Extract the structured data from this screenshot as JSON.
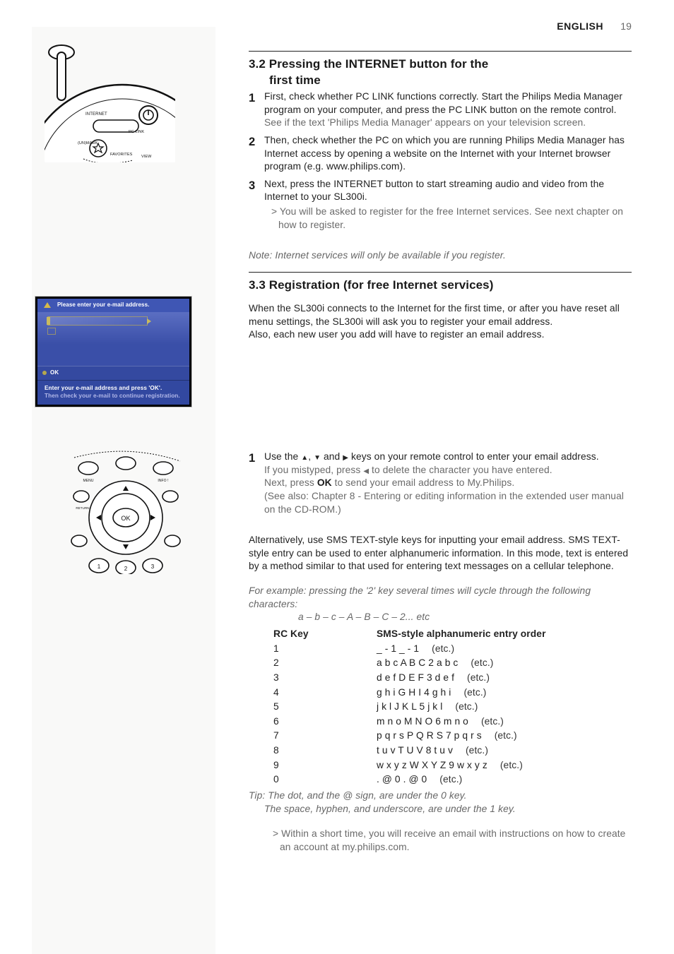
{
  "header": {
    "language": "ENGLISH",
    "page_number": "19"
  },
  "section32": {
    "heading_line1": "3.2 Pressing the INTERNET button for the",
    "heading_line2": "first time",
    "items": [
      {
        "num": "1",
        "main": "First, check whether PC LINK functions correctly. Start the Philips Media Manager program on your computer, and press the PC LINK button on the remote control.",
        "sub": "See if the text 'Philips Media Manager' appears on your television screen."
      },
      {
        "num": "2",
        "main": "Then, check whether the PC on which you are running Philips Media Manager has Internet access by opening a website on the Internet with your Internet browser program (e.g. www.philips.com).",
        "sub": ""
      },
      {
        "num": "3",
        "main": "Next, press the INTERNET button to start streaming audio and video from the Internet to your SL300i.",
        "sub": "",
        "angle": "> You will be asked to register for the free Internet services. See next chapter on how to register."
      }
    ],
    "note": "Note: Internet services will only be available if you register."
  },
  "section33": {
    "heading": "3.3 Registration (for free Internet services)",
    "intro": "When the SL300i connects to the Internet for the first time, or after you have reset all menu settings, the SL300i will ask you to register your email address.",
    "intro2": "Also, each new user you add will have to register an email address.",
    "step1": {
      "num": "1",
      "line1_pre": "Use the ",
      "line1_mid1": ", ",
      "line1_mid2": " and ",
      "line1_post": " keys on your remote control to enter your email address.",
      "line2_pre": "If you mistyped, press ",
      "line2_post": " to delete the character you have entered.",
      "line3_pre": "Next, press ",
      "line3_bold": "OK",
      "line3_post": " to send your email address to My.Philips.",
      "line4": "(See also: Chapter 8 - Entering or editing information in the extended user manual on the CD-ROM.)"
    },
    "alt_para": "Alternatively, use SMS TEXT-style keys for inputting your email address. SMS TEXT-style entry can be used to enter alphanumeric information. In this mode, text is entered by a method similar to that used for entering text messages on a cellular telephone.",
    "example_line1": "For example: pressing the '2' key several times will cycle through the following characters:",
    "example_line2": "a – b – c – A – B – C – 2... etc",
    "table": {
      "head_key": "RC Key",
      "head_val": "SMS-style alphanumeric entry order",
      "etc": "(etc.)",
      "rows": [
        {
          "key": "1",
          "val": "_  -  1  _  -  1"
        },
        {
          "key": "2",
          "val": "a  b  c  A  B  C  2  a  b  c"
        },
        {
          "key": "3",
          "val": "d  e  f  D  E  F  3  d  e  f"
        },
        {
          "key": "4",
          "val": "g  h  i  G  H  I  4  g  h  i"
        },
        {
          "key": "5",
          "val": "j  k  l  J  K  L  5  j  k  l"
        },
        {
          "key": "6",
          "val": "m  n  o  M  N  O  6  m  n  o"
        },
        {
          "key": "7",
          "val": "p  q  r  s  P  Q  R  S  7  p  q  r  s"
        },
        {
          "key": "8",
          "val": "t  u  v  T  U  V  8  t  u  v"
        },
        {
          "key": "9",
          "val": "w  x  y  z  W  X  Y  Z  9  w  x  y  z"
        },
        {
          "key": "0",
          "val": ".  @  0  .  @  0"
        }
      ]
    },
    "tip_line1": "Tip: The dot, and the @ sign, are under the 0 key.",
    "tip_line2": "The space, hyphen, and underscore, are under the 1 key.",
    "closing_angle": "> Within a short time, you will receive an email with instructions on how to create an account at my.philips.com."
  },
  "sidebar": {
    "email_screen": {
      "title": "Please enter your e-mail address.",
      "ok": "OK",
      "foot_line1": "Enter your e-mail address and press 'OK'.",
      "foot_line2": "Then check your e-mail to continue registration."
    },
    "remote_top_labels": {
      "internet": "INTERNET",
      "pclink": "PC LINK",
      "favorites": "FAVORITES",
      "ynmark": "(UN)MARK",
      "view": "VIEW"
    }
  }
}
